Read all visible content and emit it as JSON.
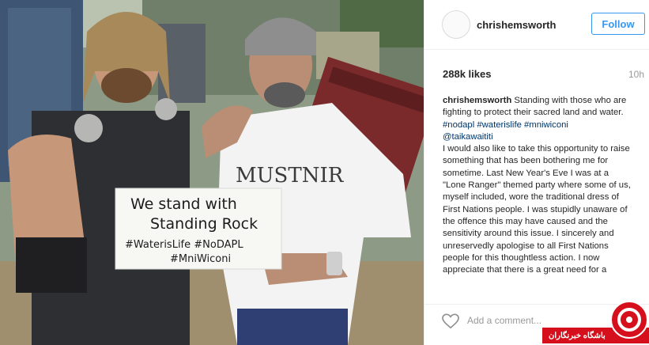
{
  "post": {
    "username": "chrishemsworth",
    "follow_label": "Follow",
    "likes": "288k likes",
    "time": "10h",
    "caption_user": "chrishemsworth",
    "caption_text_1": " Standing with those who are fighting to protect their sacred land and water. ",
    "caption_tags": [
      "#nodapl",
      "#waterislife",
      "#mniwiconi",
      "@taikawaititi"
    ],
    "caption_text_2": "I would also like to take this opportunity to raise something that has been bothering me for sometime. Last New Year's Eve I was at a \"Lone Ranger\" themed party where some of us, myself included, wore the traditional dress of First Nations people. I was stupidly unaware of the offence this may have caused and the sensitivity around this issue. I sincerely and unreservedly apologise to all First Nations people for this thoughtless action. I now appreciate that there is a great need for a",
    "add_comment_placeholder": "Add a comment...",
    "accent_color": "#3897f0"
  },
  "photo": {
    "sign_line_1": "We stand with",
    "sign_line_2": "Standing Rock",
    "sign_line_3": "#WaterisLife #NoDAPL",
    "sign_line_4": "#MniWiconi",
    "shirt_text": "MUSTNIR"
  },
  "watermark": {
    "text": "باشگاه خبرنگاران"
  }
}
